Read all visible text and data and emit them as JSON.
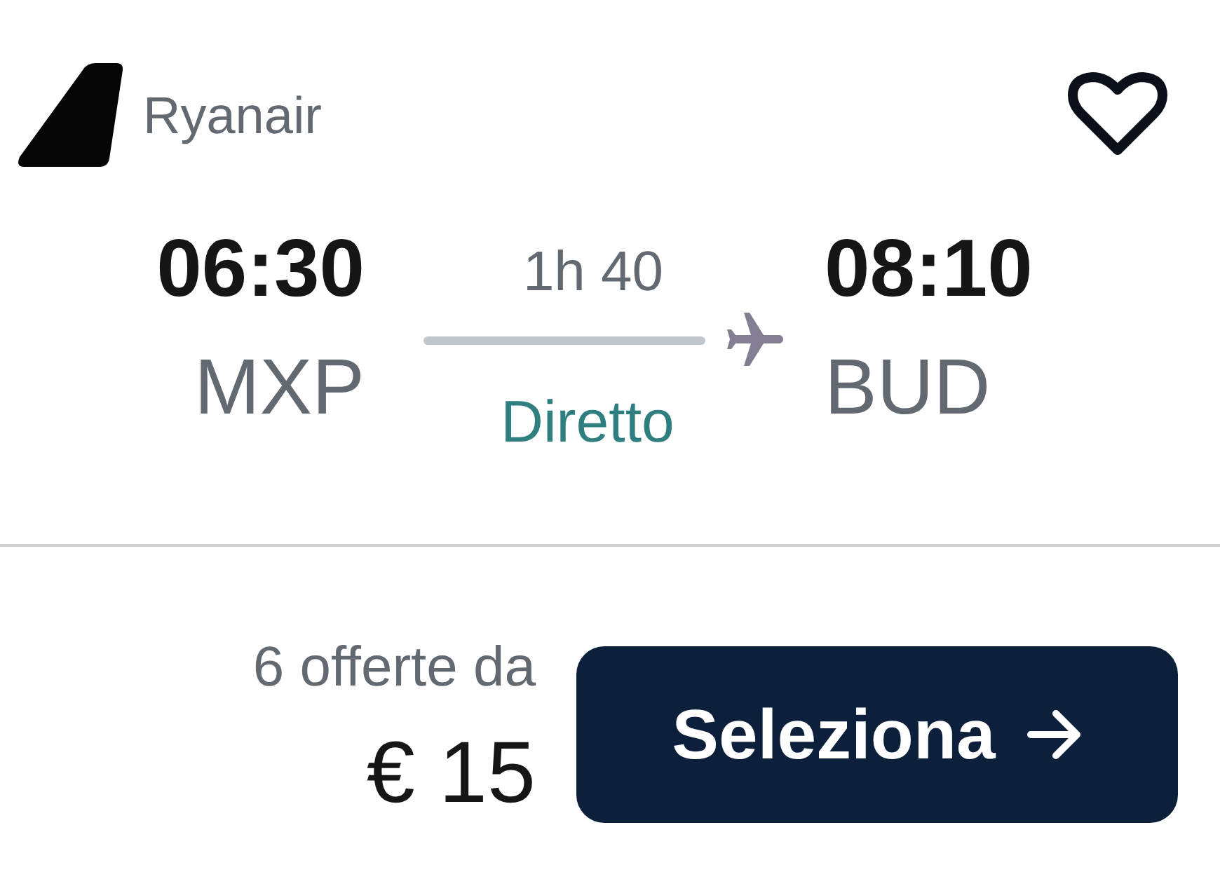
{
  "airline": {
    "name": "Ryanair"
  },
  "favorite": {
    "selected": false
  },
  "departure": {
    "time": "06:30",
    "airport": "MXP"
  },
  "journey": {
    "duration": "1h 40",
    "stops": "Diretto"
  },
  "arrival": {
    "time": "08:10",
    "airport": "BUD"
  },
  "pricing": {
    "offers": "6 offerte da",
    "price": "€ 15"
  },
  "button": {
    "label": "Seleziona"
  }
}
